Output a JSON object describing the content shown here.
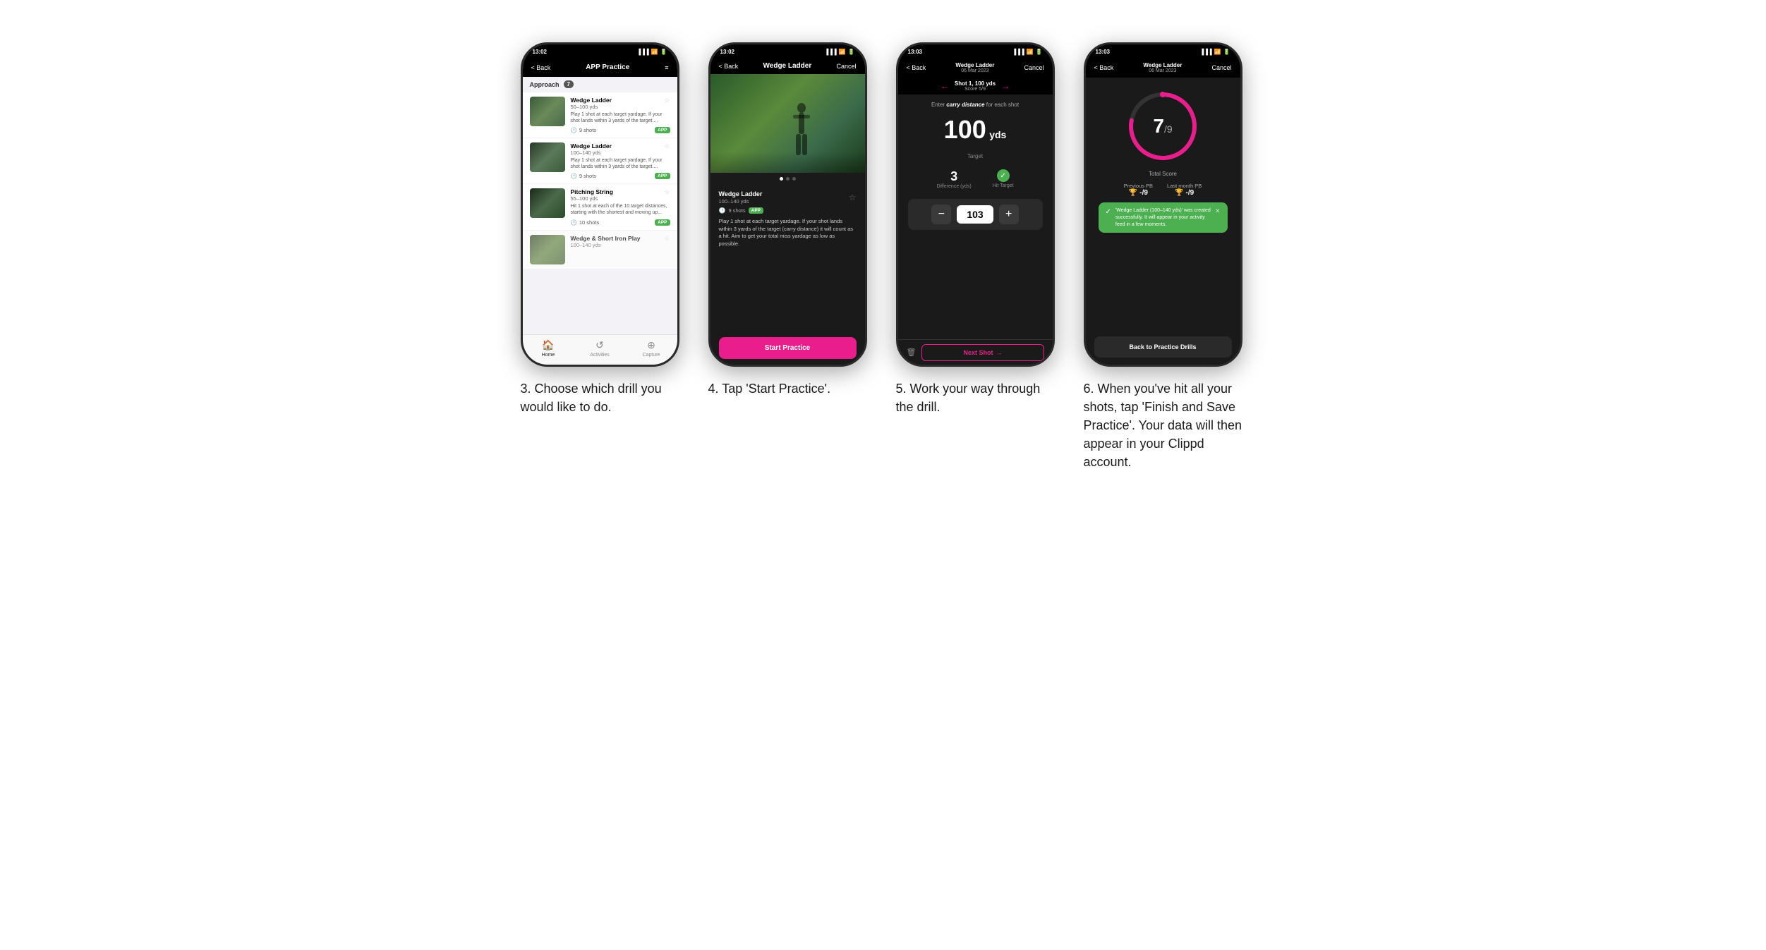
{
  "phones": [
    {
      "id": "phone1",
      "status_time": "13:02",
      "nav": {
        "back": "< Back",
        "title": "APP Practice",
        "right": "≡"
      },
      "section": {
        "label": "Approach",
        "count": "7"
      },
      "items": [
        {
          "title": "Wedge Ladder",
          "range": "50–100 yds",
          "desc": "Play 1 shot at each target yardage. If your shot lands within 3 yards of the target....",
          "shots": "9 shots",
          "badge": "APP"
        },
        {
          "title": "Wedge Ladder",
          "range": "100–140 yds",
          "desc": "Play 1 shot at each target yardage. If your shot lands within 3 yards of the target....",
          "shots": "9 shots",
          "badge": "APP"
        },
        {
          "title": "Pitching String",
          "range": "55–100 yds",
          "desc": "Hit 1 shot at each of the 10 target distances, starting with the shortest and moving up...",
          "shots": "10 shots",
          "badge": "APP"
        },
        {
          "title": "Wedge & Short Iron Play",
          "range": "100–140 yds",
          "desc": "",
          "shots": "",
          "badge": ""
        }
      ],
      "tabs": [
        {
          "label": "Home",
          "icon": "🏠",
          "active": true
        },
        {
          "label": "Activities",
          "icon": "♻",
          "active": false
        },
        {
          "label": "Capture",
          "icon": "⊕",
          "active": false
        }
      ]
    },
    {
      "id": "phone2",
      "status_time": "13:02",
      "nav": {
        "back": "< Back",
        "title": "Wedge Ladder",
        "right": "Cancel"
      },
      "card": {
        "title": "Wedge Ladder",
        "range": "100–140 yds",
        "shots": "9 shots",
        "badge": "APP",
        "desc": "Play 1 shot at each target yardage. If your shot lands within 3 yards of the target (carry distance) it will count as a hit. Aim to get your total miss yardage as low as possible."
      },
      "start_btn": "Start Practice"
    },
    {
      "id": "phone3",
      "status_time": "13:03",
      "nav": {
        "back": "< Back",
        "title_line1": "Wedge Ladder",
        "title_line2": "06 Mar 2023",
        "right": "Cancel"
      },
      "shot": {
        "label": "Shot 1, 100 yds",
        "score": "Score 5/9"
      },
      "instruction": "Enter carry distance for each shot",
      "target_yds": "100",
      "target_label": "Target",
      "difference": "3",
      "difference_label": "Difference (yds)",
      "hit_target_label": "Hit Target",
      "input_value": "103",
      "next_btn": "Next Shot"
    },
    {
      "id": "phone4",
      "status_time": "13:03",
      "nav": {
        "back": "< Back",
        "title_line1": "Wedge Ladder",
        "title_line2": "06 Mar 2023",
        "right": "Cancel"
      },
      "score": "7",
      "score_denom": "/9",
      "total_label": "Total Score",
      "previous_pb_label": "Previous PB",
      "previous_pb_val": "-/9",
      "last_month_pb_label": "Last month PB",
      "last_month_pb_val": "-/9",
      "toast": "'Wedge Ladder (100–140 yds)' was created successfully. It will appear in your activity feed in a few moments.",
      "back_btn": "Back to Practice Drills",
      "ring": {
        "score": 7,
        "total": 9,
        "color": "#e91e8c",
        "track_color": "#333"
      }
    }
  ],
  "captions": [
    "3. Choose which drill you would like to do.",
    "4. Tap 'Start Practice'.",
    "5. Work your way through the drill.",
    "6. When you've hit all your shots, tap 'Finish and Save Practice'. Your data will then appear in your Clippd account."
  ]
}
